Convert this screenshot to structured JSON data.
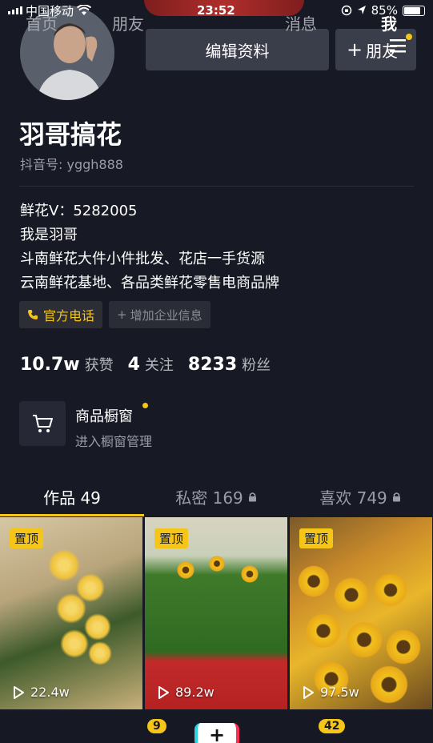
{
  "status_bar": {
    "carrier": "中国移动",
    "time": "23:52",
    "battery": "85%",
    "battery_level": 0.85
  },
  "header": {
    "edit_profile_label": "编辑资料",
    "friends_label": "朋友",
    "menu_icon": "hamburger-menu-icon"
  },
  "profile": {
    "name": "羽哥搞花",
    "douyin_id": "抖音号: yggh888",
    "bio": [
      "鲜花V：5282005",
      "我是羽哥",
      "斗南鲜花大件小件批发、花店一手货源",
      "云南鲜花基地、各品类鲜花零售电商品牌"
    ]
  },
  "tags": {
    "phone": "官方电话",
    "enterprise": "增加企业信息"
  },
  "stats": [
    {
      "num": "10.7w",
      "label": "获赞"
    },
    {
      "num": "4",
      "label": "关注"
    },
    {
      "num": "8233",
      "label": "粉丝"
    }
  ],
  "shop": {
    "title": "商品橱窗",
    "subtitle": "进入橱窗管理"
  },
  "tabs": [
    {
      "label": "作品 49",
      "locked": false
    },
    {
      "label": "私密 169",
      "locked": true
    },
    {
      "label": "喜欢 749",
      "locked": true
    }
  ],
  "videos": [
    {
      "badge": "置顶",
      "plays": "22.4w"
    },
    {
      "badge": "置顶",
      "plays": "89.2w"
    },
    {
      "badge": "置顶",
      "plays": "97.5w"
    }
  ],
  "bottom_nav": {
    "home": "首页",
    "friends": "朋友",
    "friends_badge": "9",
    "plus": "+",
    "messages": "消息",
    "messages_badge": "42",
    "me": "我"
  },
  "colors": {
    "background": "#171a24",
    "accent_yellow": "#f5c518",
    "button_bg": "#3a3d4a"
  }
}
